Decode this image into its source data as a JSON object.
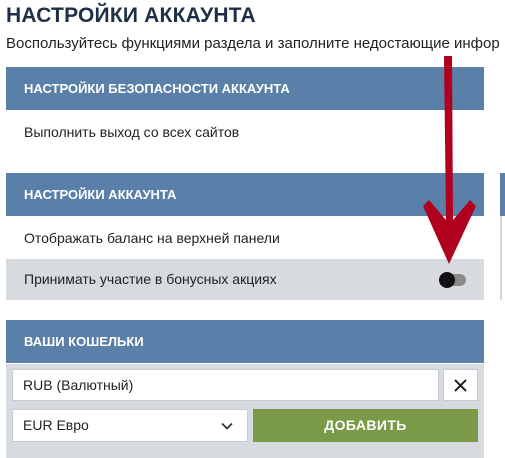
{
  "page": {
    "title": "НАСТРОЙКИ АККАУНТА",
    "subtitle": "Воспользуйтесь функциями раздела и заполните недостающие инфор"
  },
  "security_section": {
    "header": "НАСТРОЙКИ БЕЗОПАСНОСТИ АККАУНТА",
    "logout_all_label": "Выполнить выход со всех сайтов"
  },
  "account_section": {
    "header": "НАСТРОЙКИ АККАУНТА",
    "show_balance_label": "Отображать баланс на верхней панели",
    "bonus_label": "Принимать участие в бонусных акциях",
    "bonus_toggle_on": false
  },
  "wallets_section": {
    "header": "ВАШИ КОШЕЛЬКИ",
    "wallets": [
      {
        "label": "RUB (Валютный)"
      }
    ],
    "currency_select_value": "EUR Евро",
    "add_button_label": "ДОБАВИТЬ"
  },
  "colors": {
    "header_bg": "#5a80a9",
    "shaded_row_bg": "#d7dbe0",
    "add_button_bg": "#7a9a47",
    "annotation_arrow": "#b0001e"
  },
  "icons": {
    "remove_wallet": "close-icon",
    "select_expand": "chevron-down-icon",
    "annotation": "arrow-down-icon"
  }
}
